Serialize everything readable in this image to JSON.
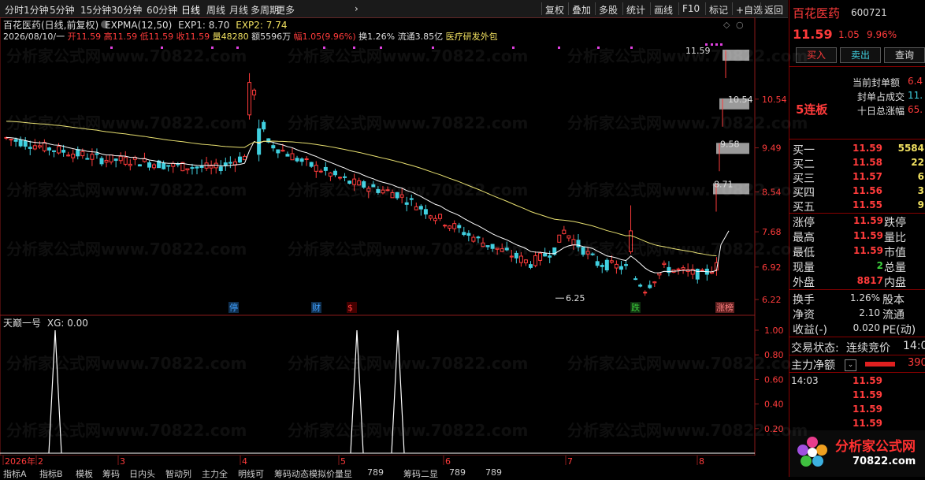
{
  "topbar": {
    "periods": [
      "分时",
      "1分钟",
      "5分钟",
      "15分钟",
      "30分钟",
      "60分钟",
      "日线",
      "周线",
      "月线",
      "多周期",
      "更多"
    ],
    "tools": [
      "复权",
      "叠加",
      "多股",
      "统计",
      "画线",
      "F10",
      "标记",
      "+自选",
      "返回"
    ],
    "active": "日线"
  },
  "chart_header": {
    "name": "百花医药(日线,前复权)",
    "indicator": "EXPMA(12,50)",
    "exp1": "EXP1: 8.70",
    "exp2": "EXP2: 7.74",
    "date": "2026/08/10/一",
    "open": "开11.59",
    "high": "高11.59",
    "low": "低11.59",
    "close": "收11.59",
    "vol": "量48280",
    "amount": "额5596万",
    "change": "幅1.05(9.96%)",
    "turnover": "换1.26%",
    "float": "流通3.85亿",
    "sector": "医疗研发外包"
  },
  "price_axis": [
    "10.54",
    "9.49",
    "8.54",
    "7.68",
    "6.92",
    "6.22"
  ],
  "price_marks": {
    "high": "11.59",
    "low": "6.25",
    "m1": "10.54",
    "m2": "9.58",
    "m3": "8.71"
  },
  "event_tags": [
    "停",
    "财",
    "$",
    "跌",
    "涨榜"
  ],
  "indicator_panel": {
    "name": "天巅一号",
    "value": "XG: 0.00",
    "axis": [
      "1.00",
      "0.80",
      "0.60",
      "0.40",
      "0.20"
    ]
  },
  "time_axis": {
    "labels": [
      "2026年",
      "2",
      "3",
      "4",
      "5",
      "6",
      "7",
      "8"
    ]
  },
  "bottom_tabs": [
    "指标A",
    "指标B",
    "模板",
    "筹码",
    "日内头",
    "智动列",
    "主力全",
    "明线可",
    "筹码动态模拟价量显",
    "789",
    "筹码二显",
    "789",
    "789"
  ],
  "watermark": "分析家公式网www.70822.com",
  "right_panel": {
    "stock_name": "百花医药",
    "code": "600721",
    "price": "11.59",
    "change": "1.05",
    "pct": "9.96%",
    "buy_btn": "买入",
    "sell_btn": "卖出",
    "query_btn": "查询",
    "streak": "5连板",
    "stat_labels": [
      "当前封单额",
      "封单占成交",
      "十日总涨幅"
    ],
    "stat_values": [
      "6.4",
      "11.",
      "65."
    ],
    "bids": [
      {
        "label": "买一",
        "price": "11.59",
        "vol": "5584"
      },
      {
        "label": "买二",
        "price": "11.58",
        "vol": "22"
      },
      {
        "label": "买三",
        "price": "11.57",
        "vol": "6"
      },
      {
        "label": "买四",
        "price": "11.56",
        "vol": "3"
      },
      {
        "label": "买五",
        "price": "11.55",
        "vol": "9"
      }
    ],
    "quote_rows": [
      {
        "l": "涨停",
        "v": "11.59",
        "r": "跌停"
      },
      {
        "l": "最高",
        "v": "11.59",
        "r": "量比"
      },
      {
        "l": "最低",
        "v": "11.59",
        "r": "市值"
      },
      {
        "l": "现量",
        "v": "2",
        "r": "总量"
      },
      {
        "l": "外盘",
        "v": "8817",
        "r": "内盘"
      }
    ],
    "fund_rows": [
      {
        "l": "换手",
        "v": "1.26%",
        "r": "股本"
      },
      {
        "l": "净资",
        "v": "2.10",
        "r": "流通"
      },
      {
        "l": "收益(-)",
        "v": "0.020",
        "r": "PE(动)"
      }
    ],
    "trade_status_label": "交易状态:",
    "trade_status": "连续竞价",
    "trade_time": "14:0",
    "main_force_label": "主力净额",
    "main_force_value": "390",
    "ticks": [
      {
        "time": "14:03",
        "price": "11.59"
      },
      {
        "time": "",
        "price": "11.59"
      },
      {
        "time": "",
        "price": "11.59"
      },
      {
        "time": "",
        "price": "11.59"
      }
    ],
    "logo_text": "分析家公式网",
    "logo_url": "70822.com"
  },
  "colors": {
    "up": "#ff3b3b",
    "down": "#40d0e0",
    "exp1": "#ffffff",
    "exp2": "#e8e070",
    "bg": "#000000"
  }
}
